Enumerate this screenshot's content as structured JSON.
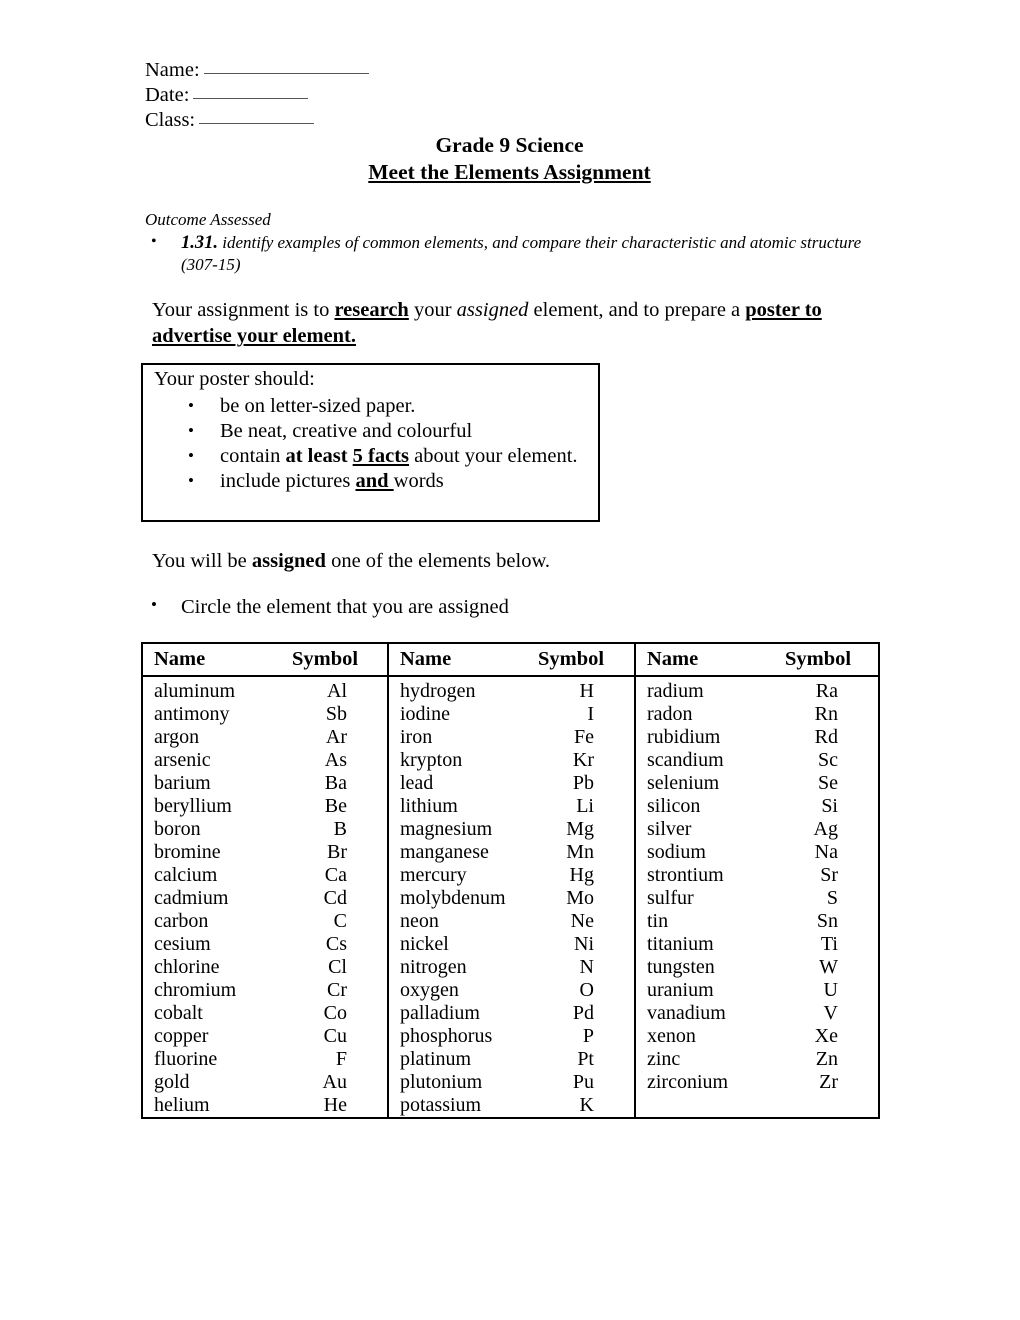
{
  "header_fields": [
    {
      "label": "Name:",
      "value": "",
      "blank_class": "blank-name"
    },
    {
      "label": "Date:",
      "value": "",
      "blank_class": "blank-date"
    },
    {
      "label": "Class:",
      "value": "",
      "blank_class": "blank-class"
    }
  ],
  "title": {
    "line1": "Grade 9 Science",
    "line2": "Meet the Elements Assignment"
  },
  "outcome": {
    "heading": "Outcome Assessed",
    "code": "1.31.",
    "text": " identify examples of common elements, and compare their characteristic and atomic structure (307-15)"
  },
  "assignment": {
    "p1": "Your assignment is to ",
    "research": "research",
    "p2": " your ",
    "assigned": "assigned",
    "p3": " element, and to prepare a ",
    "poster": "poster to advertise your element."
  },
  "poster_box": {
    "title": "Your poster should:",
    "items": [
      {
        "pre": "be on letter-sized paper.",
        "bold": "",
        "boldunder": "",
        "post": ""
      },
      {
        "pre": "Be neat, creative and colourful",
        "bold": "",
        "boldunder": "",
        "post": ""
      },
      {
        "pre": "contain ",
        "bold": "at least ",
        "boldunder": "5 facts",
        "post": " about your element."
      },
      {
        "pre": "include pictures ",
        "bold": "",
        "boldunder": "and ",
        "post": " words"
      }
    ]
  },
  "assigned_note": {
    "pre": "You will be ",
    "bold": "assigned",
    "post": " one of the elements below."
  },
  "circle_instruction": "Circle the element that you are assigned",
  "table": {
    "headers": [
      "Name",
      "Symbol",
      "Name",
      "Symbol",
      "Name",
      "Symbol"
    ],
    "columns": [
      [
        [
          "aluminum",
          "Al"
        ],
        [
          "antimony",
          "Sb"
        ],
        [
          "argon",
          "Ar"
        ],
        [
          "arsenic",
          "As"
        ],
        [
          "barium",
          "Ba"
        ],
        [
          "beryllium",
          "Be"
        ],
        [
          "boron",
          "B"
        ],
        [
          "bromine",
          "Br"
        ],
        [
          "calcium",
          "Ca"
        ],
        [
          "cadmium",
          "Cd"
        ],
        [
          "carbon",
          "C"
        ],
        [
          "cesium",
          "Cs"
        ],
        [
          "chlorine",
          "Cl"
        ],
        [
          "chromium",
          "Cr"
        ],
        [
          "cobalt",
          "Co"
        ],
        [
          "copper",
          "Cu"
        ],
        [
          "fluorine",
          "F"
        ],
        [
          "gold",
          "Au"
        ],
        [
          "helium",
          "He"
        ]
      ],
      [
        [
          "hydrogen",
          "H"
        ],
        [
          "iodine",
          "I"
        ],
        [
          "iron",
          "Fe"
        ],
        [
          "krypton",
          "Kr"
        ],
        [
          "lead",
          "Pb"
        ],
        [
          "lithium",
          "Li"
        ],
        [
          "magnesium",
          "Mg"
        ],
        [
          "manganese",
          "Mn"
        ],
        [
          "mercury",
          "Hg"
        ],
        [
          "molybdenum",
          "Mo"
        ],
        [
          "neon",
          "Ne"
        ],
        [
          "nickel",
          "Ni"
        ],
        [
          "nitrogen",
          "N"
        ],
        [
          "oxygen",
          "O"
        ],
        [
          "palladium",
          "Pd"
        ],
        [
          "phosphorus",
          "P"
        ],
        [
          "platinum",
          "Pt"
        ],
        [
          "plutonium",
          "Pu"
        ],
        [
          "potassium",
          "K"
        ]
      ],
      [
        [
          "radium",
          "Ra"
        ],
        [
          "radon",
          "Rn"
        ],
        [
          "rubidium",
          "Rd"
        ],
        [
          "scandium",
          "Sc"
        ],
        [
          "selenium",
          "Se"
        ],
        [
          "silicon",
          "Si"
        ],
        [
          "silver",
          "Ag"
        ],
        [
          "sodium",
          "Na"
        ],
        [
          "strontium",
          "Sr"
        ],
        [
          "sulfur",
          "S"
        ],
        [
          "tin",
          "Sn"
        ],
        [
          "titanium",
          "Ti"
        ],
        [
          "tungsten",
          "W"
        ],
        [
          "uranium",
          "U"
        ],
        [
          "vanadium",
          "V"
        ],
        [
          "xenon",
          "Xe"
        ],
        [
          "zinc",
          "Zn"
        ],
        [
          "zirconium",
          "Zr"
        ],
        [
          "",
          ""
        ]
      ]
    ]
  }
}
